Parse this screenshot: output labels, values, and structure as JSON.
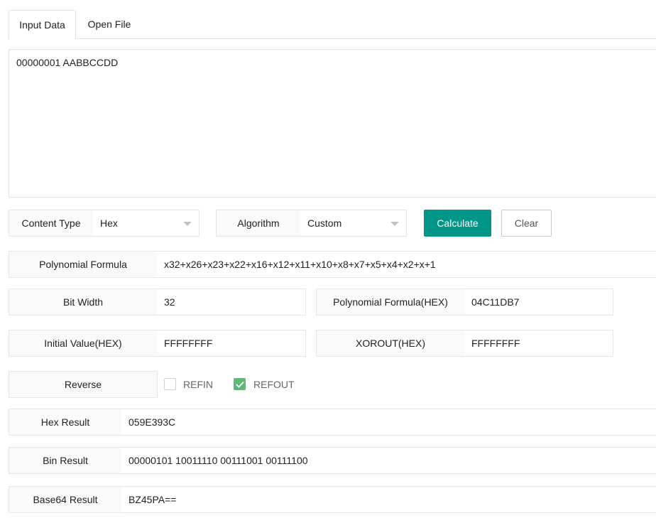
{
  "tabs": [
    {
      "label": "Input Data",
      "active": true
    },
    {
      "label": "Open File",
      "active": false
    }
  ],
  "input": {
    "value": "00000001 AABBCCDD"
  },
  "content_type": {
    "label": "Content Type",
    "selected": "Hex"
  },
  "algorithm": {
    "label": "Algorithm",
    "selected": "Custom"
  },
  "buttons": {
    "calculate": "Calculate",
    "clear": "Clear"
  },
  "polynomial_formula": {
    "label": "Polynomial Formula",
    "value": "x32+x26+x23+x22+x16+x12+x11+x10+x8+x7+x5+x4+x2+x+1"
  },
  "bit_width": {
    "label": "Bit Width",
    "value": "32"
  },
  "polynomial_hex": {
    "label": "Polynomial Formula(HEX)",
    "value": "04C11DB7"
  },
  "initial_value": {
    "label": "Initial Value(HEX)",
    "value": "FFFFFFFF"
  },
  "xorout": {
    "label": "XOROUT(HEX)",
    "value": "FFFFFFFF"
  },
  "reverse": {
    "label": "Reverse",
    "refin": {
      "label": "REFIN",
      "checked": false
    },
    "refout": {
      "label": "REFOUT",
      "checked": true
    }
  },
  "results": {
    "hex": {
      "label": "Hex Result",
      "value": "059E393C"
    },
    "bin": {
      "label": "Bin Result",
      "value": "00000101 10011110 00111001 00111100"
    },
    "base64": {
      "label": "Base64 Result",
      "value": "BZ45PA=="
    }
  },
  "colors": {
    "primary": "#009688",
    "checkbox_checked": "#5fb878"
  }
}
